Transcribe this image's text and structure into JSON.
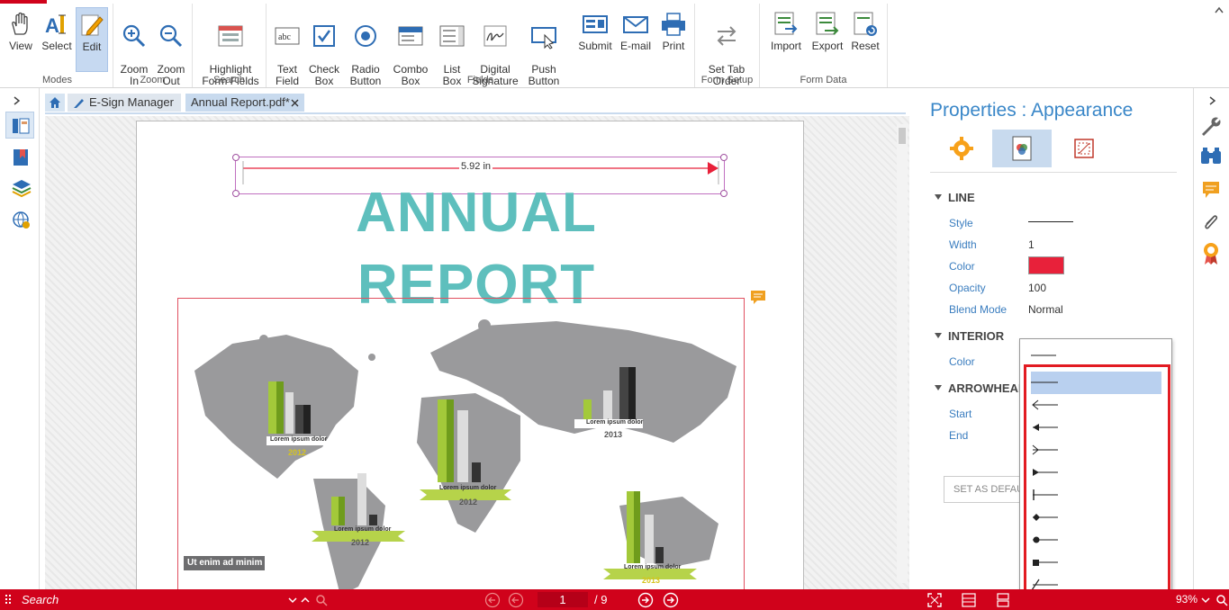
{
  "ribbon": {
    "groups": [
      {
        "label": "Modes",
        "buttons": [
          "View",
          "Select",
          "Edit"
        ]
      },
      {
        "label": "Zoom",
        "buttons": [
          "Zoom\nIn",
          "Zoom\nOut"
        ]
      },
      {
        "label": "Search",
        "buttons": [
          "Highlight\nForm Fields"
        ]
      },
      {
        "label": "Fields",
        "buttons": [
          "Text\nField",
          "Check\nBox",
          "Radio\nButton",
          "Combo\nBox",
          "List\nBox",
          "Digital\nSignature",
          "Push\nButton",
          "Submit",
          "E-mail",
          "Print"
        ]
      },
      {
        "label": "Form Setup",
        "buttons": [
          "Set Tab\nOrder"
        ]
      },
      {
        "label": "Form Data",
        "buttons": [
          "Import",
          "Export",
          "Reset"
        ]
      }
    ]
  },
  "tabs": {
    "esign": "E-Sign Manager",
    "report": "Annual Report.pdf*"
  },
  "document": {
    "measure_label": "5.92 in",
    "title": "ANNUAL REPORT",
    "map_labels": [
      "Lorem ipsum dolor",
      "Lorem ipsum dolor",
      "Lorem ipsum dolor",
      "Lorem ipsum dolor",
      "Lorem ipsum dolor"
    ],
    "years": [
      "2012",
      "2012",
      "2012",
      "2013",
      "2013"
    ],
    "caption": "Ut enim ad minim"
  },
  "properties": {
    "title": "Properties : Appearance",
    "sections": {
      "line": "LINE",
      "interior": "INTERIOR",
      "arrowhead": "ARROWHEAD"
    },
    "labels": {
      "style": "Style",
      "width": "Width",
      "color": "Color",
      "opacity": "Opacity",
      "blend": "Blend Mode",
      "int_color": "Color",
      "start": "Start",
      "end": "End"
    },
    "values": {
      "width": "1",
      "opacity": "100",
      "blend": "Normal"
    },
    "set_default": "SET AS DEFAULT",
    "line_color": "#e8213a"
  },
  "status": {
    "search_placeholder": "Search",
    "page": "1",
    "total": "/ 9",
    "zoom": "93%"
  }
}
